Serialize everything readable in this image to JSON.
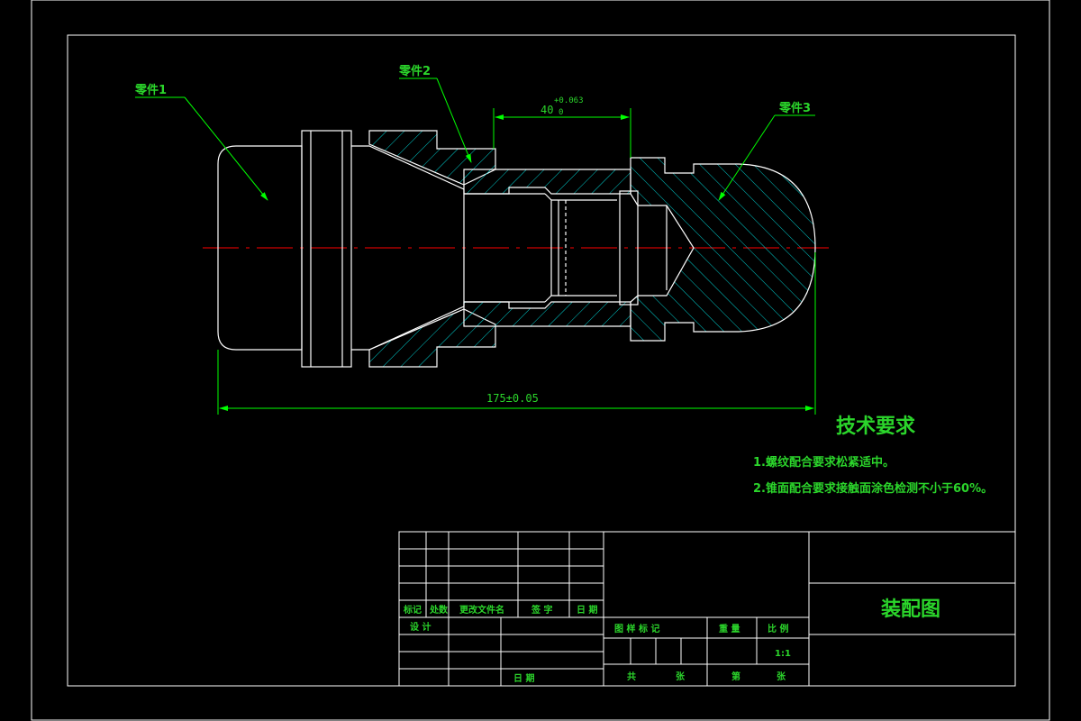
{
  "drawing": {
    "part_labels": [
      "零件1",
      "零件2",
      "零件3"
    ],
    "dimension_40": "40",
    "tolerance_upper": "+0.063",
    "tolerance_lower": "0",
    "dimension_175": "175±0.05"
  },
  "technical_requirements": {
    "title": "技术要求",
    "items": [
      "1.螺纹配合要求松紧适中。",
      "2.锥面配合要求接触面涂色检测不小于60%。"
    ]
  },
  "title_block": {
    "drawing_name": "装配图",
    "rev_headers": [
      "标记",
      "处数",
      "更改文件名",
      "签 字",
      "日 期"
    ],
    "design_label": "设 计",
    "date_label": "日 期",
    "stage_label": "图 样 标 记",
    "weight_label": "重 量",
    "scale_label": "比 例",
    "scale_value": "1:1",
    "total_sheets_label": "共",
    "sheet_label": "张",
    "this_sheet_label": "第",
    "this_sheet_unit": "张"
  },
  "colors": {
    "background": "#000000",
    "outline": "#ffffff",
    "annotation": "#00ff00",
    "hatch": "#00cccc",
    "centerline": "#ff0000"
  }
}
